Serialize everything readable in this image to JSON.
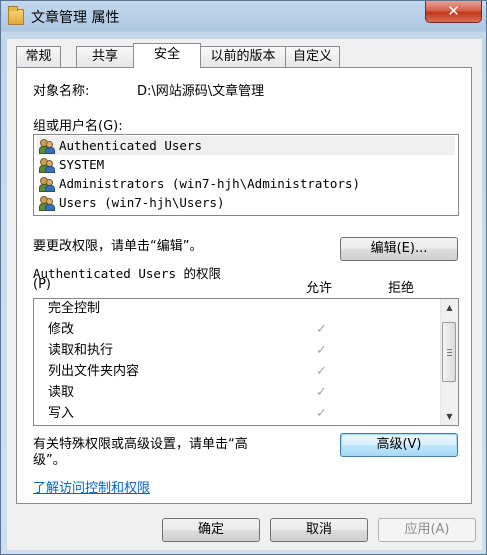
{
  "window": {
    "title": "文章管理 属性",
    "close_label": "✕"
  },
  "tabs": [
    "常规",
    "共享",
    "安全",
    "以前的版本",
    "自定义"
  ],
  "active_tab": "安全",
  "object": {
    "label": "对象名称:",
    "value": "D:\\网站源码\\文章管理"
  },
  "groups": {
    "label": "组或用户名(G):",
    "items": [
      "Authenticated Users",
      "SYSTEM",
      "Administrators (win7-hjh\\Administrators)",
      "Users (win7-hjh\\Users)"
    ],
    "selected_index": 0
  },
  "edit": {
    "hint": "要更改权限，请单击“编辑”。",
    "button": "编辑(E)..."
  },
  "permissions": {
    "title_line1": "Authenticated Users 的权限",
    "title_line2": "(P)",
    "col_allow": "允许",
    "col_deny": "拒绝",
    "rows": [
      {
        "name": "完全控制",
        "allow": ""
      },
      {
        "name": "修改",
        "allow": "✓"
      },
      {
        "name": "读取和执行",
        "allow": "✓"
      },
      {
        "name": "列出文件夹内容",
        "allow": "✓"
      },
      {
        "name": "读取",
        "allow": "✓"
      },
      {
        "name": "写入",
        "allow": "✓"
      }
    ]
  },
  "advanced": {
    "hint_line1": "有关特殊权限或高级设置，请单击“高",
    "hint_line2": "级”。",
    "button": "高级(V)"
  },
  "learn_link": "了解访问控制和权限",
  "footer": {
    "ok": "确定",
    "cancel": "取消",
    "apply": "应用(A)"
  },
  "scrollbar": {
    "up": "▲",
    "down": "▼"
  }
}
